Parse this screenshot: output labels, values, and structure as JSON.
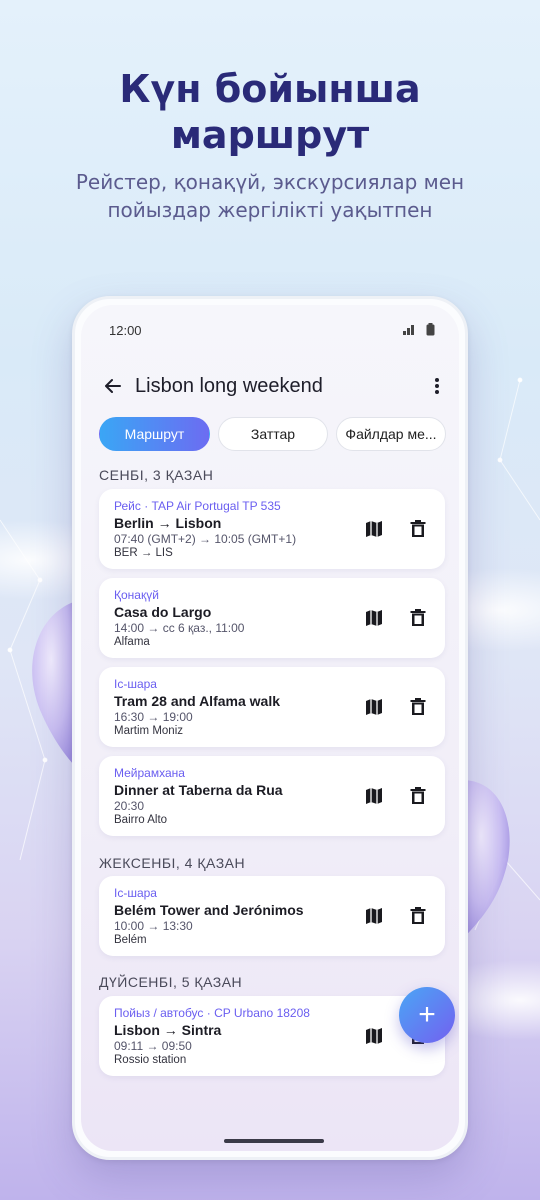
{
  "promo": {
    "headline_line1": "Күн бойынша",
    "headline_line2": "маршрут",
    "subline_line1": "Рейстер, қонақүй, экскурсиялар мен",
    "subline_line2": "пойыздар жергілікті уақытпен"
  },
  "status_bar": {
    "time": "12:00",
    "icons": [
      "signal-icon",
      "battery-icon"
    ]
  },
  "app_bar": {
    "title": "Lisbon long weekend",
    "back_icon": "back-arrow-icon",
    "menu_icon": "more-vert-icon"
  },
  "tabs": [
    {
      "label": "Маршрут",
      "active": true
    },
    {
      "label": "Заттар",
      "active": false
    },
    {
      "label": "Файлдар ме...",
      "active": false
    }
  ],
  "days": [
    {
      "header": "СЕНБІ, 3 ҚАЗАН",
      "items": [
        {
          "type": "Рейс · TAP Air Portugal TP 535",
          "name": "Berlin → Lisbon",
          "time": "07:40 (GMT+2) → 10:05 (GMT+1)",
          "place": "BER → LIS"
        },
        {
          "type": "Қонақүй",
          "name": "Casa do Largo",
          "time": "14:00 → сс 6 қаз., 11:00",
          "place": "Alfama"
        },
        {
          "type": "Іс-шара",
          "name": "Tram 28 and Alfama walk",
          "time": "16:30 → 19:00",
          "place": "Martim Moniz"
        },
        {
          "type": "Мейрамхана",
          "name": "Dinner at Taberna da Rua",
          "time": "20:30",
          "place": "Bairro Alto"
        }
      ]
    },
    {
      "header": "ЖЕКСЕНБІ, 4 ҚАЗАН",
      "items": [
        {
          "type": "Іс-шара",
          "name": "Belém Tower and Jerónimos",
          "time": "10:00 → 13:30",
          "place": "Belém"
        }
      ]
    },
    {
      "header": "ДҮЙСЕНБІ, 5 ҚАЗАН",
      "items": [
        {
          "type": "Пойыз / автобус · CP Urbano 18208",
          "name": "Lisbon → Sintra",
          "time": "09:11 → 09:50",
          "place": "Rossio station"
        }
      ]
    }
  ],
  "fab": {
    "label": "+",
    "icon": "add-icon"
  },
  "colors": {
    "accent": "#6a5ef0",
    "headline": "#2a2a78",
    "tab_gradient_start": "#3aa6f5",
    "tab_gradient_end": "#6c6cf2"
  }
}
